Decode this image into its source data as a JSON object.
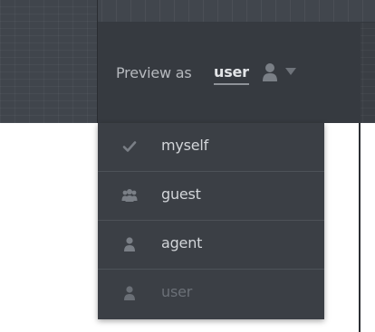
{
  "preview": {
    "label": "Preview as",
    "current_value": "user",
    "icons": {
      "user": "user-icon",
      "caret": "caret-down-icon"
    }
  },
  "dropdown": {
    "items": [
      {
        "label": "myself",
        "icon": "check-icon",
        "state": "checked"
      },
      {
        "label": "guest",
        "icon": "group-icon",
        "state": "default"
      },
      {
        "label": "agent",
        "icon": "user-icon",
        "state": "default"
      },
      {
        "label": "user",
        "icon": "user-icon",
        "state": "disabled-current"
      }
    ]
  },
  "colors": {
    "header_bg": "#3a3e44",
    "dropdown_bg": "#3b3f45",
    "text_light": "#d2d5d9",
    "text_muted": "#6b7077",
    "icon_gray": "#7a7f86"
  }
}
